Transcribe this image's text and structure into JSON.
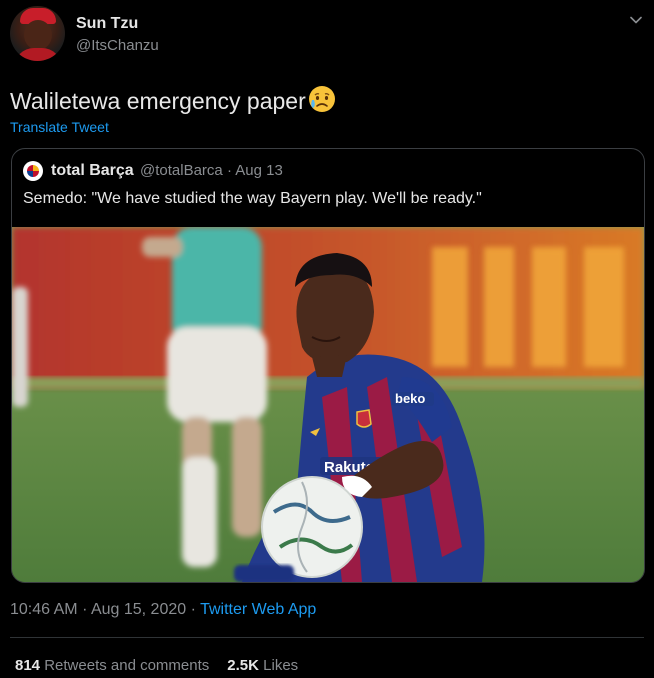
{
  "author": {
    "display_name": "Sun Tzu",
    "handle": "@ItsChanzu",
    "avatar_icon": "profile-photo-red-cap"
  },
  "tweet": {
    "text": "Waliletewa emergency paper",
    "emoji_icon": "sad-but-relieved-face-emoji",
    "translate_label": "Translate Tweet"
  },
  "quoted_tweet": {
    "display_name": "total Barça",
    "handle": "@totalBarca",
    "separator": "·",
    "date": "Aug 13",
    "text": "Semedo: \"We have studied the way Bayern play. We'll be ready.\"",
    "media_description_icon": "football-player-photo"
  },
  "meta": {
    "time": "10:46 AM",
    "separator": "·",
    "date": "Aug 15, 2020",
    "app": "Twitter Web App"
  },
  "stats": {
    "retweets_count": "814",
    "retweets_label": "Retweets and comments",
    "likes_count": "2.5K",
    "likes_label": "Likes"
  },
  "colors": {
    "background": "#000000",
    "link": "#1d9bf0",
    "muted": "#8a8d91",
    "border": "#3b3e42"
  }
}
